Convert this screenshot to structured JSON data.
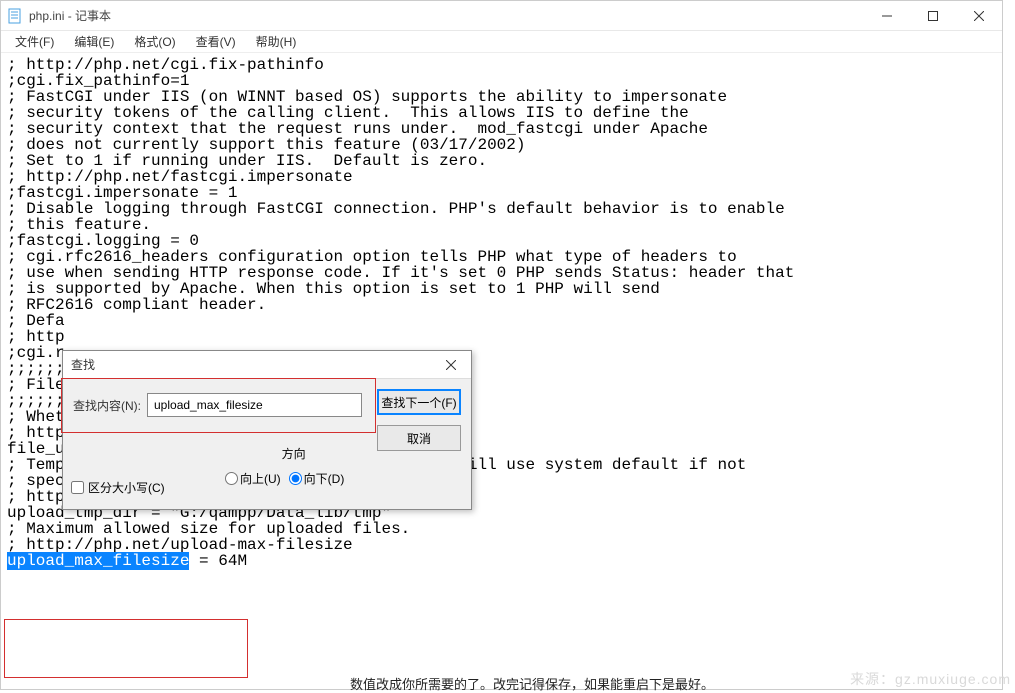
{
  "window": {
    "title": "php.ini - 记事本"
  },
  "menu": {
    "file": "文件(F)",
    "edit": "编辑(E)",
    "format": "格式(O)",
    "view": "查看(V)",
    "help": "帮助(H)"
  },
  "content": {
    "lines": [
      "; http://php.net/cgi.fix-pathinfo",
      ";cgi.fix_pathinfo=1",
      "",
      "; FastCGI under IIS (on WINNT based OS) supports the ability to impersonate",
      "; security tokens of the calling client.  This allows IIS to define the",
      "; security context that the request runs under.  mod_fastcgi under Apache",
      "; does not currently support this feature (03/17/2002)",
      "; Set to 1 if running under IIS.  Default is zero.",
      "; http://php.net/fastcgi.impersonate",
      ";fastcgi.impersonate = 1",
      "",
      "; Disable logging through FastCGI connection. PHP's default behavior is to enable",
      "; this feature.",
      ";fastcgi.logging = 0",
      "",
      "; cgi.rfc2616_headers configuration option tells PHP what type of headers to",
      "; use when sending HTTP response code. If it's set 0 PHP sends Status: header that",
      "; is supported by Apache. When this option is set to 1 PHP will send",
      "; RFC2616 compliant header.",
      "; Defa",
      "; http",
      ";cgi.r",
      "",
      ";;;;;;",
      "; File",
      ";;;;;;",
      "",
      "; Wheth",
      "; http",
      "file_uploads = On",
      "",
      "; Temporary directory for HTTP uploaded files (will use system default if not",
      "; specified).",
      "; http://php.net/upload-tmp-dir",
      "upload_tmp_dir = \"G:/qampp/Data_lib/tmp\"",
      "",
      "; Maximum allowed size for uploaded files.",
      "; http://php.net/upload-max-filesize"
    ],
    "highlighted": "upload_max_filesize",
    "after_highlight": " = 64M"
  },
  "find_dialog": {
    "title": "查找",
    "label": "查找内容(N):",
    "value": "upload_max_filesize",
    "find_next": "查找下一个(F)",
    "cancel": "取消",
    "direction_label": "方向",
    "up": "向上(U)",
    "down": "向下(D)",
    "match_case": "区分大小写(C)"
  },
  "watermark": "来源：gz.muxiuge.com",
  "truncated": "数值改成你所需要的了。改完记得保存，如果能重启下是最好。"
}
